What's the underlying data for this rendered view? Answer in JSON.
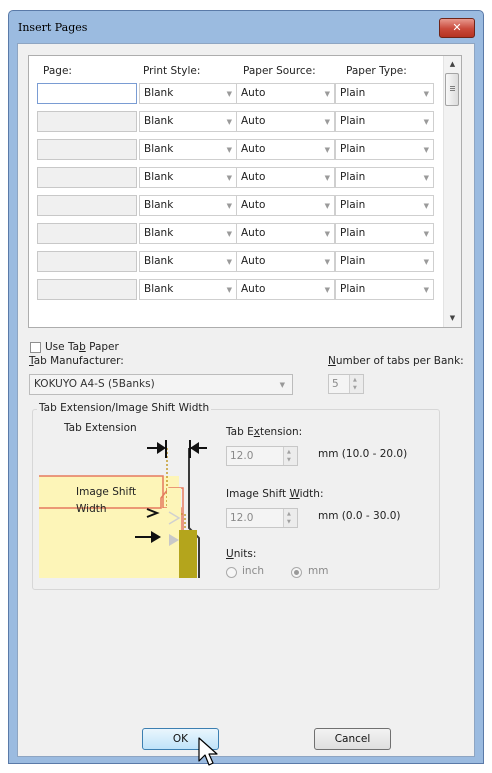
{
  "window": {
    "title": "Insert Pages",
    "close_icon": "close-icon"
  },
  "list": {
    "headers": [
      "Page:",
      "Print Style:",
      "Paper Source:",
      "Paper Type:"
    ],
    "rows": [
      {
        "page": "",
        "style": "Blank",
        "source": "Auto",
        "type": "Plain"
      },
      {
        "page": "",
        "style": "Blank",
        "source": "Auto",
        "type": "Plain"
      },
      {
        "page": "",
        "style": "Blank",
        "source": "Auto",
        "type": "Plain"
      },
      {
        "page": "",
        "style": "Blank",
        "source": "Auto",
        "type": "Plain"
      },
      {
        "page": "",
        "style": "Blank",
        "source": "Auto",
        "type": "Plain"
      },
      {
        "page": "",
        "style": "Blank",
        "source": "Auto",
        "type": "Plain"
      },
      {
        "page": "",
        "style": "Blank",
        "source": "Auto",
        "type": "Plain"
      },
      {
        "page": "",
        "style": "Blank",
        "source": "Auto",
        "type": "Plain"
      }
    ]
  },
  "tab_paper": {
    "use_tab_paper_pre": "Use Ta",
    "use_tab_paper_key": "b",
    "use_tab_paper_post": " Paper",
    "use_tab_paper_checked": false,
    "manufacturer_key": "T",
    "manufacturer_post": "ab Manufacturer:",
    "manufacturer_value": "KOKUYO A4-S (5Banks)",
    "tabs_per_bank_key": "N",
    "tabs_per_bank_post": "umber of tabs per Bank:",
    "tabs_per_bank_value": "5"
  },
  "group": {
    "title": "Tab Extension/Image Shift Width",
    "diagram_tab_extension": "Tab Extension",
    "diagram_image_shift": "Image Shift",
    "diagram_width": "Width",
    "tab_extension_pre": "Tab E",
    "tab_extension_key": "x",
    "tab_extension_post": "tension:",
    "tab_extension_value": "12.0",
    "tab_extension_range": "mm (10.0 - 20.0)",
    "image_shift_pre": "Image Shift ",
    "image_shift_key": "W",
    "image_shift_post": "idth:",
    "image_shift_value": "12.0",
    "image_shift_range": "mm (0.0 - 30.0)",
    "units_key": "U",
    "units_post": "nits:",
    "unit_inch": "inch",
    "unit_mm": "mm",
    "selected_unit": "mm"
  },
  "buttons": {
    "ok": "OK",
    "cancel": "Cancel"
  },
  "colors": {
    "title_bar": "#9bbbe0",
    "close_button": "#c9493a",
    "diagram_paper": "#fdf5b8",
    "diagram_border": "#e57a5f",
    "diagram_tab": "#b4a51c"
  }
}
